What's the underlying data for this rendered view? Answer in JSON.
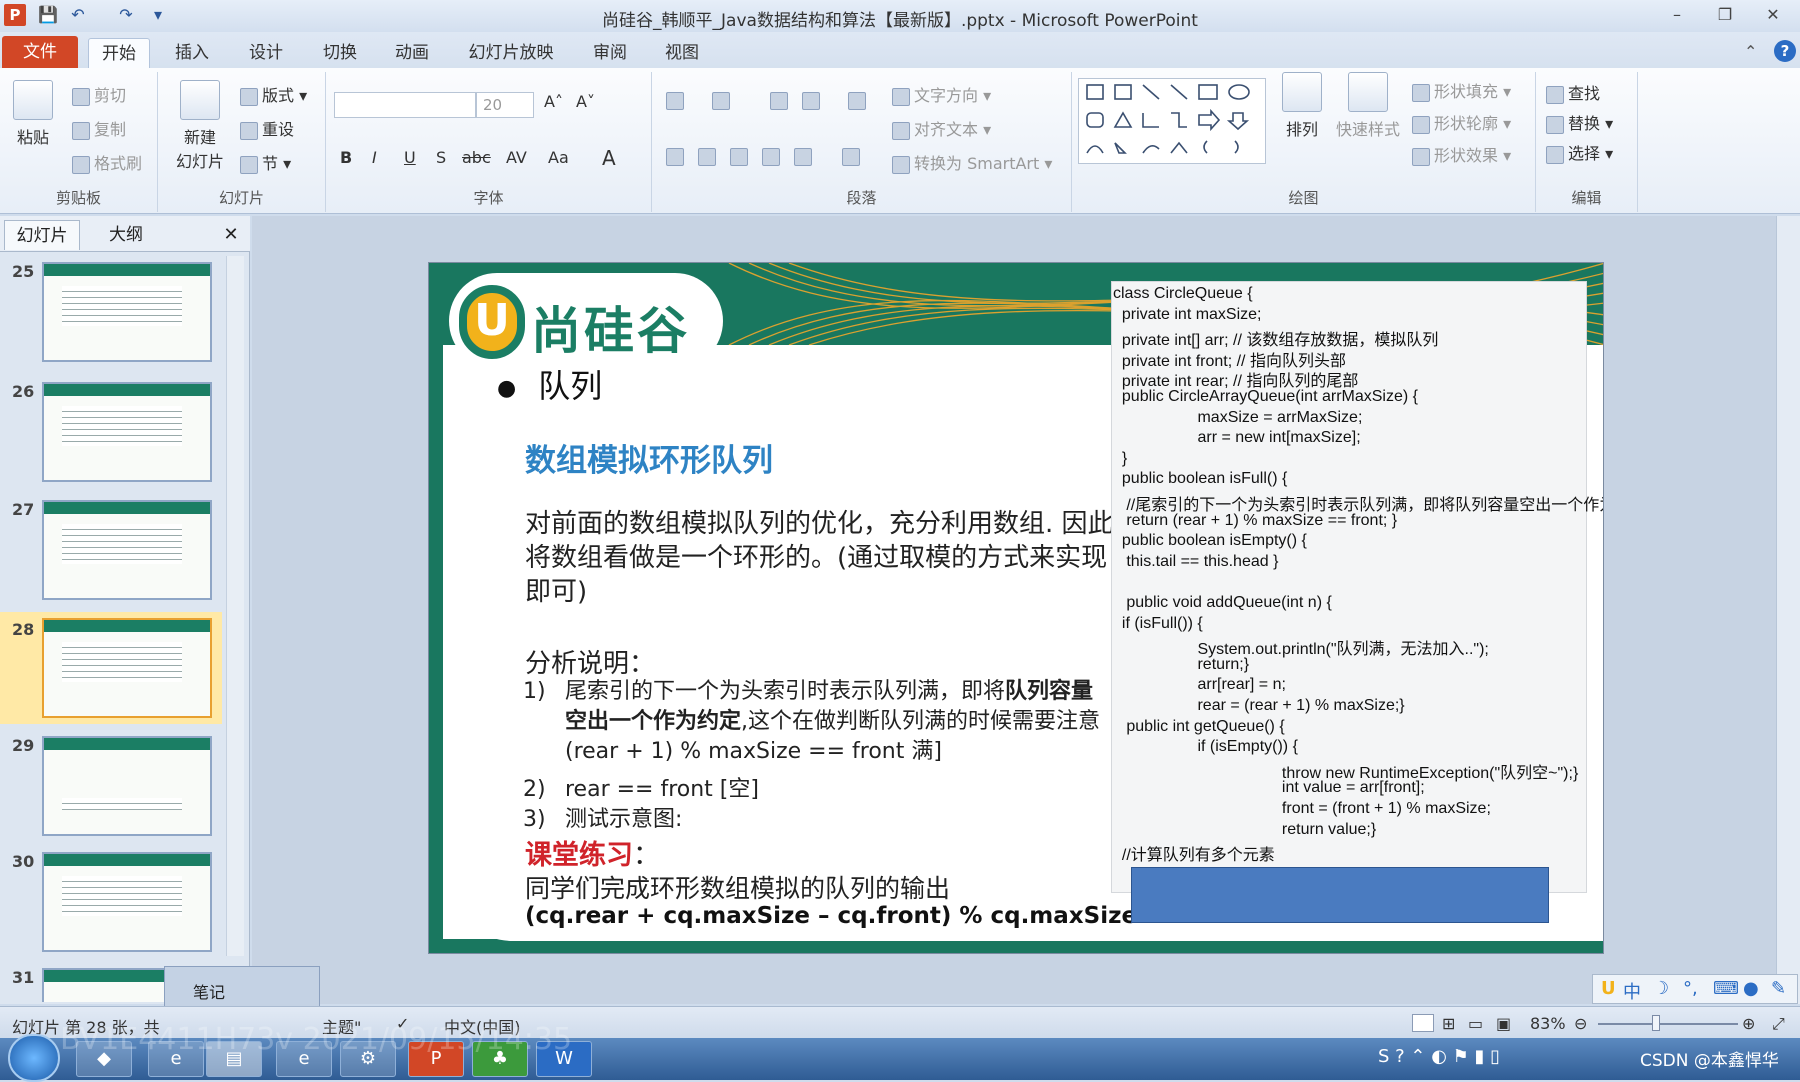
{
  "window": {
    "title": "尚硅谷_韩顺平_Java数据结构和算法【最新版】.pptx - Microsoft PowerPoint",
    "min": "–",
    "max": "❐",
    "close": "✕",
    "help": "?",
    "collapse": "⌃"
  },
  "quick_access": {
    "app": "P",
    "save": "💾",
    "undo": "↶",
    "redo": "↷",
    "more": "▾"
  },
  "tabs": {
    "file": "文件",
    "items": [
      "开始",
      "插入",
      "设计",
      "切换",
      "动画",
      "幻灯片放映",
      "审阅",
      "视图"
    ]
  },
  "ribbon": {
    "clipboard": {
      "label": "剪贴板",
      "paste": "粘贴",
      "cut": "剪切",
      "copy": "复制",
      "format_painter": "格式刷"
    },
    "slides": {
      "label": "幻灯片",
      "new_slide_1": "新建",
      "new_slide_2": "幻灯片",
      "layout": "版式",
      "reset": "重设",
      "section": "节"
    },
    "font": {
      "label": "字体",
      "size": "20",
      "bold": "B",
      "italic": "I",
      "underline": "U",
      "shadow": "S",
      "strike": "abc",
      "spacing": "AV",
      "case": "Aa",
      "grow": "A˄",
      "shrink": "A˅",
      "clear": "A"
    },
    "paragraph": {
      "label": "段落",
      "text_direction": "文字方向",
      "align_text": "对齐文本",
      "smartart": "转换为 SmartArt"
    },
    "drawing": {
      "label": "绘图",
      "arrange": "排列",
      "quick_styles": "快速样式",
      "fill": "形状填充",
      "outline": "形状轮廓",
      "effects": "形状效果"
    },
    "editing": {
      "label": "编辑",
      "find": "查找",
      "replace": "替换",
      "select": "选择"
    }
  },
  "pane": {
    "tab_slides": "幻灯片",
    "tab_outline": "大纲",
    "close": "✕",
    "thumbs": [
      "25",
      "26",
      "27",
      "28",
      "29",
      "30",
      "31"
    ],
    "selected": "28"
  },
  "slide": {
    "logo": "尚硅谷",
    "logo_mark": "U",
    "heading": "队列",
    "section_title": "数组模拟环形队列",
    "intro": "对前面的数组模拟队列的优化，充分利用数组. 因此将数组看做是一个环形的。(通过取模的方式来实现即可)",
    "analysis_title": "分析说明：",
    "items": [
      {
        "num": "1)",
        "pre": "尾索引的下一个为头索引时表示队列满，即将",
        "bold": "队列容量空出一个作为约定",
        "post": ",这个在做判断队列满的时候需要注意 (rear + 1) % maxSize == front 满]"
      },
      {
        "num": "2)",
        "text": "rear == front [空]"
      },
      {
        "num": "3)",
        "text": "测试示意图:"
      }
    ],
    "exercise_title": "课堂练习",
    "exercise_colon": "：",
    "exercise_text": "同学们完成环形数组模拟的队列的输出",
    "exercise_formula": "(cq.rear + cq.maxSize – cq.front) % cq.maxSize",
    "code": [
      "class CircleQueue {",
      "  private int maxSize;",
      "  private int[] arr; // 该数组存放数据，模拟队列",
      "  private int front; // 指向队列头部",
      "  private int rear; // 指向队列的尾部",
      "  public CircleArrayQueue(int arrMaxSize) {",
      "                   maxSize = arrMaxSize;",
      "                   arr = new int[maxSize];",
      "  }",
      "  public boolean isFull() {",
      "   //尾索引的下一个为头索引时表示队列满，即将队列容量空出一个作为约定(!!!)",
      "   return (rear + 1) % maxSize == front; }",
      "  public boolean isEmpty() {",
      "   this.tail == this.head }",
      "",
      "   public void addQueue(int n) {",
      "  if (isFull()) {",
      "                   System.out.println(\"队列满，无法加入..\");",
      "                   return;}",
      "                   arr[rear] = n;",
      "                   rear = (rear + 1) % maxSize;}",
      "   public int getQueue() {",
      "                   if (isEmpty()) {",
      "                                      throw new RuntimeException(\"队列空~\");}",
      "                                      int value = arr[front];",
      "                                      front = (front + 1) % maxSize;",
      "                                      return value;}",
      "  //计算队列有多个元素"
    ]
  },
  "tooltip": "笔记",
  "status": {
    "slide_info": "幻灯片 第 28 张，共",
    "theme": "主题\"",
    "language": "中文(中国)",
    "zoom": "83%"
  },
  "ime": {
    "mode": "中"
  },
  "taskbar": {
    "watermark": "CSDN @本鑫悍华",
    "ts": "BV1E4411H73v 2021/09/15/14:35"
  },
  "colors": {
    "accent_green": "#1b7e64",
    "file_tab": "#d24726",
    "title_blue": "#2e83c4",
    "exercise_red": "#d0232a",
    "code_box_fill": "#4a7bc0"
  }
}
